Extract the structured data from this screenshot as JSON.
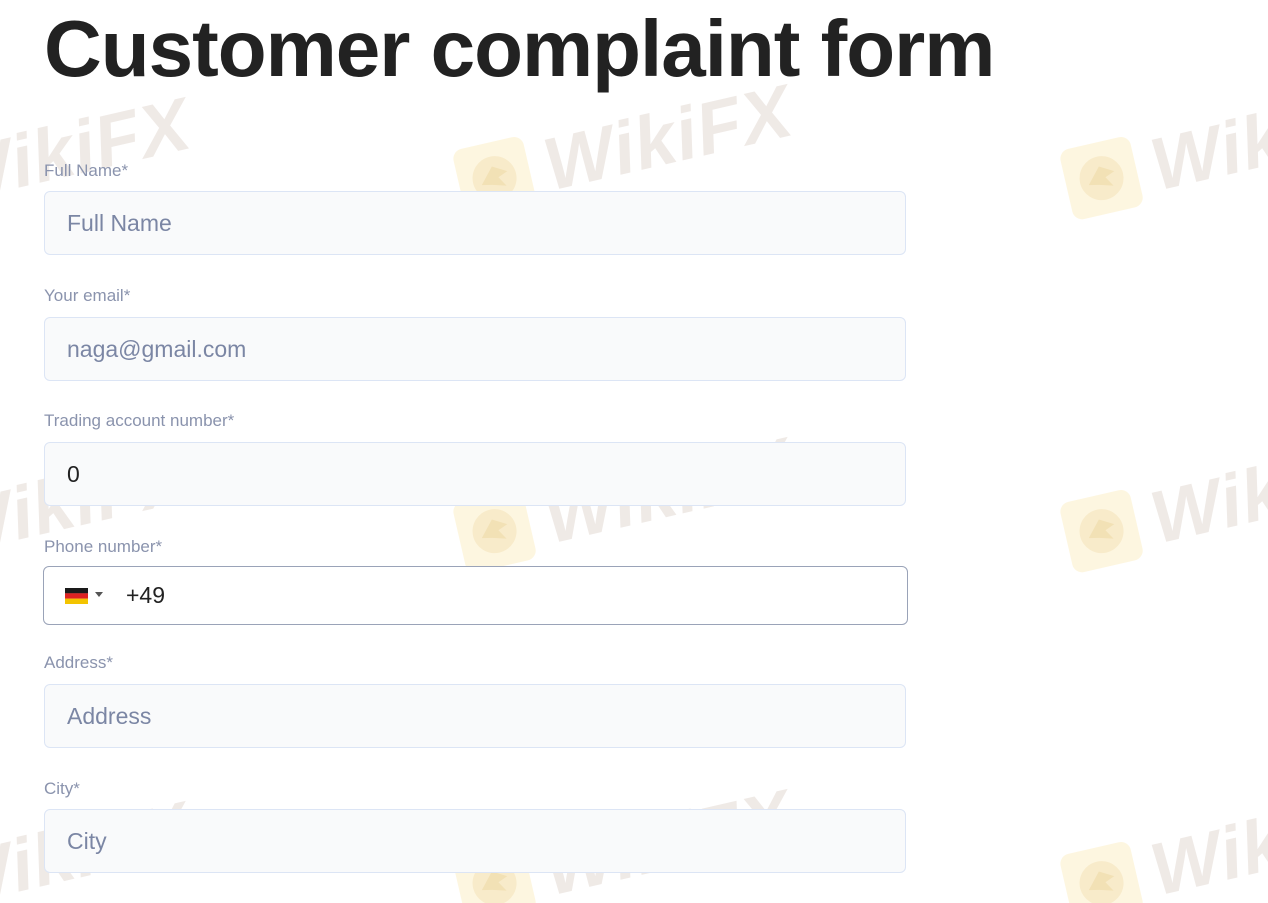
{
  "page": {
    "title": "Customer complaint form"
  },
  "watermark": {
    "text": "WikiFX",
    "logo_icon": "eagle-icon"
  },
  "form": {
    "full_name": {
      "label": "Full Name*",
      "placeholder": "Full Name",
      "value": ""
    },
    "email": {
      "label": "Your email*",
      "placeholder": "naga@gmail.com",
      "value": ""
    },
    "trading_account": {
      "label": "Trading account number*",
      "value": "0"
    },
    "phone": {
      "label": "Phone number*",
      "country_flag": "germany-flag-icon",
      "value": "+49"
    },
    "address": {
      "label": "Address*",
      "placeholder": "Address",
      "value": ""
    },
    "city": {
      "label": "City*",
      "placeholder": "City",
      "value": ""
    }
  },
  "colors": {
    "title": "#222222",
    "label": "#8a93ad",
    "placeholder": "#7b86a4",
    "field_bg": "#f9fafb",
    "field_border": "#dce5f5",
    "phone_border": "#9aa3b8"
  }
}
